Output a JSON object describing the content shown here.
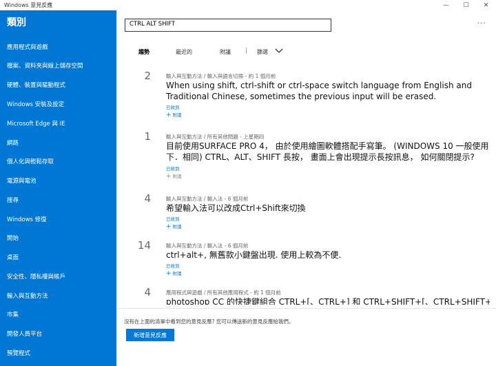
{
  "window": {
    "title": "Windows 意見反應",
    "minimize": "—",
    "maximize": "☐",
    "close": "✕"
  },
  "sidebar": {
    "title": "類別",
    "items": [
      "應用程式與遊戲",
      "檔案、資料夾與線上儲存空間",
      "硬體、裝置與驅動程式",
      "Windows 安裝及設定",
      "Microsoft Edge 與 IE",
      "網路",
      "個人化與輕鬆存取",
      "電源與電池",
      "搜尋",
      "Windows 修復",
      "開始",
      "桌面",
      "安全性、隱私權與帳戶",
      "輸入與互動方法",
      "市集",
      "開發人員平台",
      "預覽程式"
    ]
  },
  "search": {
    "value": "CTRL ALT SHIFT"
  },
  "more_label": "···",
  "tabs": {
    "trending": "趨勢",
    "recent": "最近的",
    "attachments": "附議",
    "separator": "|",
    "filter": "篩選"
  },
  "items": [
    {
      "votes": "2",
      "category": "輸入與互動方法 / 輸入與語言切換 - 約 1 個月前",
      "title": "When using shift, ctrl-shift or ctrl-space switch language from English and Traditional Chinese, sometimes the previous input will be erased.",
      "status": "已收到",
      "attach": "附議"
    },
    {
      "votes": "1",
      "category": "輸入與互動方法 / 所有其他問題 - 上星期四",
      "title": "目前使用SURFACE PRO 4， 由於使用繪圖軟體搭配手寫筆。 (WINDOWS 10 一般使用下．相同) CTRL、ALT、SHIFT 長按， 畫面上會出現提示長按訊息， 如何關閉提示?",
      "status": "已收到",
      "attach": "附議"
    },
    {
      "votes": "4",
      "category": "輸入與互動方法 / 輸入法 - 6 個月前",
      "title": "希望輸入法可以改成Ctrl+Shift來切換",
      "status": "已收到",
      "attach": "附議"
    },
    {
      "votes": "14",
      "category": "輸入與互動方法 / 輸入法 - 6 個月前",
      "title": "ctrl+alt+, 無舊款小鍵盤出現. 使用上較為不便.",
      "status": "已收到",
      "attach": "附議"
    },
    {
      "votes": "4",
      "category": "應用程式與遊戲 / 所有其他應用程式 - 約 1 個月前",
      "title": "photoshop CC 的快捷鍵組合 CTRL+[、CTRL+] 和 CTRL+SHIFT+[、CTRL+SHIFT+]，使"
    }
  ],
  "footer": {
    "text": "沒有在上面的清單中看到您的意見反應? 您可以傳送新的意見反應給我們。",
    "button": "新增意見反應"
  },
  "colors": {
    "sidebar": "#0077d4",
    "accent": "#0078d7"
  }
}
